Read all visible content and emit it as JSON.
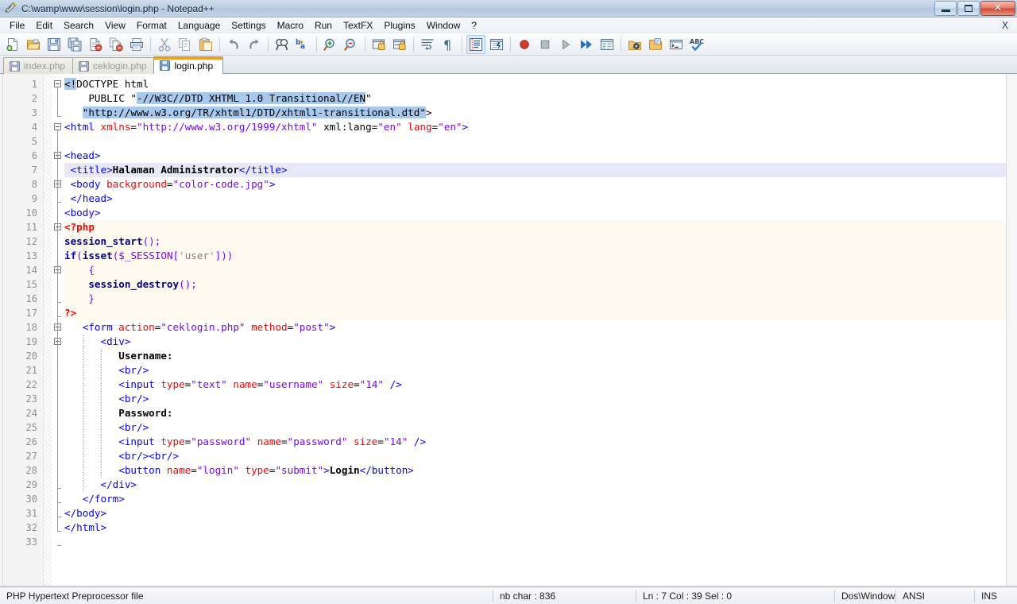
{
  "window": {
    "title": "C:\\wamp\\www\\session\\login.php - Notepad++",
    "icon": "notepad-plus-plus-icon",
    "controls": {
      "minimize": "minimize-button",
      "restore": "restore-button",
      "close": "close-button"
    },
    "accent": "#f0a024"
  },
  "menubar": {
    "items": [
      {
        "label": "File"
      },
      {
        "label": "Edit"
      },
      {
        "label": "Search"
      },
      {
        "label": "View"
      },
      {
        "label": "Format"
      },
      {
        "label": "Language"
      },
      {
        "label": "Settings"
      },
      {
        "label": "Macro"
      },
      {
        "label": "Run"
      },
      {
        "label": "TextFX"
      },
      {
        "label": "Plugins"
      },
      {
        "label": "Window"
      },
      {
        "label": "?"
      }
    ],
    "close_document": "X"
  },
  "toolbar": {
    "buttons": [
      {
        "name": "new-file-icon"
      },
      {
        "name": "open-file-icon"
      },
      {
        "name": "save-icon"
      },
      {
        "name": "save-all-icon"
      },
      {
        "name": "close-file-icon"
      },
      {
        "name": "close-all-files-icon"
      },
      {
        "name": "print-icon"
      },
      {
        "name": "separator"
      },
      {
        "name": "cut-icon"
      },
      {
        "name": "copy-icon"
      },
      {
        "name": "paste-icon"
      },
      {
        "name": "separator"
      },
      {
        "name": "undo-icon"
      },
      {
        "name": "redo-icon"
      },
      {
        "name": "separator"
      },
      {
        "name": "find-icon"
      },
      {
        "name": "replace-icon"
      },
      {
        "name": "separator"
      },
      {
        "name": "zoom-in-icon"
      },
      {
        "name": "zoom-out-icon"
      },
      {
        "name": "separator"
      },
      {
        "name": "sync-vertical-scroll-icon"
      },
      {
        "name": "sync-horizontal-scroll-icon"
      },
      {
        "name": "separator"
      },
      {
        "name": "word-wrap-icon"
      },
      {
        "name": "show-all-characters-icon"
      },
      {
        "name": "separator"
      },
      {
        "name": "indent-guideline-icon"
      },
      {
        "name": "user-defined-dialog-icon"
      },
      {
        "name": "separator"
      },
      {
        "name": "record-macro-icon"
      },
      {
        "name": "stop-recording-macro-icon"
      },
      {
        "name": "play-macro-icon"
      },
      {
        "name": "run-macro-multiple-times-icon"
      },
      {
        "name": "save-macro-icon"
      },
      {
        "name": "separator"
      },
      {
        "name": "run-icon"
      },
      {
        "name": "open-folder-icon"
      },
      {
        "name": "launch-console-icon"
      },
      {
        "name": "spell-check-icon"
      }
    ]
  },
  "tabs": [
    {
      "label": "index.php",
      "active": false,
      "icon": "saved-file-icon"
    },
    {
      "label": "ceklogin.php",
      "active": false,
      "icon": "saved-file-icon"
    },
    {
      "label": "login.php",
      "active": true,
      "icon": "saved-file-icon"
    }
  ],
  "editor": {
    "line_count": 33,
    "current_line": 7,
    "lines": [
      {
        "n": 1,
        "indent": 0,
        "bg": "none",
        "tokens": [
          {
            "t": "<!",
            "c": "t-dtd",
            "sel": true
          },
          {
            "t": "DOCTYPE html",
            "c": "t-dtd"
          }
        ]
      },
      {
        "n": 2,
        "indent": 0,
        "bg": "none",
        "tokens": [
          {
            "t": "    PUBLIC \"",
            "c": "t-dtd"
          },
          {
            "t": "-//W3C//DTD XHTML 1.0 Transitional//EN",
            "c": "t-dtd",
            "sel": true
          },
          {
            "t": "\"",
            "c": "t-dtd"
          }
        ]
      },
      {
        "n": 3,
        "indent": 0,
        "bg": "none",
        "tokens": [
          {
            "t": "   ",
            "c": "t-dtd"
          },
          {
            "t": "\"http://www.w3.org/TR/xhtml1/DTD/xhtml1-transitional.dtd\"",
            "c": "t-dtd",
            "sel": true
          },
          {
            "t": ">",
            "c": "t-dtd"
          }
        ]
      },
      {
        "n": 4,
        "indent": 0,
        "bg": "none",
        "tokens": [
          {
            "t": "<html ",
            "c": "t-tag"
          },
          {
            "t": "xmlns",
            "c": "t-attr"
          },
          {
            "t": "=",
            "c": "t-plain"
          },
          {
            "t": "\"http://www.w3.org/1999/xhtml\"",
            "c": "t-val"
          },
          {
            "t": " xml:lang",
            "c": "t-plain"
          },
          {
            "t": "=",
            "c": "t-plain"
          },
          {
            "t": "\"en\"",
            "c": "t-val"
          },
          {
            "t": " ",
            "c": "t-plain"
          },
          {
            "t": "lang",
            "c": "t-attr"
          },
          {
            "t": "=",
            "c": "t-plain"
          },
          {
            "t": "\"en\"",
            "c": "t-val"
          },
          {
            "t": ">",
            "c": "t-tag"
          }
        ]
      },
      {
        "n": 5,
        "indent": 0,
        "bg": "none",
        "tokens": []
      },
      {
        "n": 6,
        "indent": 0,
        "bg": "none",
        "tokens": [
          {
            "t": "<head>",
            "c": "t-tag"
          }
        ]
      },
      {
        "n": 7,
        "indent": 0,
        "bg": "curline",
        "tokens": [
          {
            "t": " <title>",
            "c": "t-tag"
          },
          {
            "t": "Halaman Administrator",
            "c": "t-txt"
          },
          {
            "t": "</title>",
            "c": "t-tag"
          }
        ]
      },
      {
        "n": 8,
        "indent": 0,
        "bg": "none",
        "tokens": [
          {
            "t": " <body ",
            "c": "t-tag"
          },
          {
            "t": "background",
            "c": "t-attr"
          },
          {
            "t": "=",
            "c": "t-plain"
          },
          {
            "t": "\"color-code.jpg\"",
            "c": "t-val"
          },
          {
            "t": ">",
            "c": "t-tag"
          }
        ]
      },
      {
        "n": 9,
        "indent": 0,
        "bg": "none",
        "tokens": [
          {
            "t": " </head>",
            "c": "t-tag"
          }
        ]
      },
      {
        "n": 10,
        "indent": 0,
        "bg": "none",
        "tokens": [
          {
            "t": "<body>",
            "c": "t-tag"
          }
        ]
      },
      {
        "n": 11,
        "indent": 0,
        "bg": "php",
        "tokens": [
          {
            "t": "<?php",
            "c": "t-php"
          }
        ]
      },
      {
        "n": 12,
        "indent": 0,
        "bg": "php",
        "tokens": [
          {
            "t": "session_start",
            "c": "t-fn"
          },
          {
            "t": "();",
            "c": "t-sym"
          }
        ]
      },
      {
        "n": 13,
        "indent": 0,
        "bg": "php",
        "tokens": [
          {
            "t": "if",
            "c": "t-kw"
          },
          {
            "t": "(",
            "c": "t-sym"
          },
          {
            "t": "isset",
            "c": "t-fn"
          },
          {
            "t": "(",
            "c": "t-sym"
          },
          {
            "t": "$_SESSION",
            "c": "t-var"
          },
          {
            "t": "[",
            "c": "t-sym"
          },
          {
            "t": "'user'",
            "c": "t-str"
          },
          {
            "t": "]))",
            "c": "t-sym"
          }
        ]
      },
      {
        "n": 14,
        "indent": 0,
        "bg": "php",
        "tokens": [
          {
            "t": "    {",
            "c": "t-sym"
          }
        ]
      },
      {
        "n": 15,
        "indent": 0,
        "bg": "php",
        "tokens": [
          {
            "t": "    ",
            "c": "t-plain"
          },
          {
            "t": "session_destroy",
            "c": "t-fn"
          },
          {
            "t": "();",
            "c": "t-sym"
          }
        ]
      },
      {
        "n": 16,
        "indent": 0,
        "bg": "php",
        "tokens": [
          {
            "t": "    }",
            "c": "t-sym"
          }
        ]
      },
      {
        "n": 17,
        "indent": 0,
        "bg": "php",
        "tokens": [
          {
            "t": "?>",
            "c": "t-php"
          }
        ]
      },
      {
        "n": 18,
        "indent": 0,
        "bg": "none",
        "tokens": [
          {
            "t": "   <form ",
            "c": "t-tag"
          },
          {
            "t": "action",
            "c": "t-attr"
          },
          {
            "t": "=",
            "c": "t-plain"
          },
          {
            "t": "\"ceklogin.php\"",
            "c": "t-val"
          },
          {
            "t": " ",
            "c": "t-plain"
          },
          {
            "t": "method",
            "c": "t-attr"
          },
          {
            "t": "=",
            "c": "t-plain"
          },
          {
            "t": "\"post\"",
            "c": "t-val"
          },
          {
            "t": ">",
            "c": "t-tag"
          }
        ]
      },
      {
        "n": 19,
        "indent": 0,
        "bg": "none",
        "tokens": [
          {
            "t": "      <div>",
            "c": "t-tag"
          }
        ]
      },
      {
        "n": 20,
        "indent": 0,
        "bg": "none",
        "tokens": [
          {
            "t": "         Username:",
            "c": "t-txt"
          }
        ]
      },
      {
        "n": 21,
        "indent": 0,
        "bg": "none",
        "tokens": [
          {
            "t": "         <br/>",
            "c": "t-tag"
          }
        ]
      },
      {
        "n": 22,
        "indent": 0,
        "bg": "none",
        "tokens": [
          {
            "t": "         <input ",
            "c": "t-tag"
          },
          {
            "t": "type",
            "c": "t-attr"
          },
          {
            "t": "=",
            "c": "t-plain"
          },
          {
            "t": "\"text\"",
            "c": "t-val"
          },
          {
            "t": " ",
            "c": "t-plain"
          },
          {
            "t": "name",
            "c": "t-attr"
          },
          {
            "t": "=",
            "c": "t-plain"
          },
          {
            "t": "\"username\"",
            "c": "t-val"
          },
          {
            "t": " ",
            "c": "t-plain"
          },
          {
            "t": "size",
            "c": "t-attr"
          },
          {
            "t": "=",
            "c": "t-plain"
          },
          {
            "t": "\"14\"",
            "c": "t-val"
          },
          {
            "t": " />",
            "c": "t-tag"
          }
        ]
      },
      {
        "n": 23,
        "indent": 0,
        "bg": "none",
        "tokens": [
          {
            "t": "         <br/>",
            "c": "t-tag"
          }
        ]
      },
      {
        "n": 24,
        "indent": 0,
        "bg": "none",
        "tokens": [
          {
            "t": "         Password:",
            "c": "t-txt"
          }
        ]
      },
      {
        "n": 25,
        "indent": 0,
        "bg": "none",
        "tokens": [
          {
            "t": "         <br/>",
            "c": "t-tag"
          }
        ]
      },
      {
        "n": 26,
        "indent": 0,
        "bg": "none",
        "tokens": [
          {
            "t": "         <input ",
            "c": "t-tag"
          },
          {
            "t": "type",
            "c": "t-attr"
          },
          {
            "t": "=",
            "c": "t-plain"
          },
          {
            "t": "\"password\"",
            "c": "t-val"
          },
          {
            "t": " ",
            "c": "t-plain"
          },
          {
            "t": "name",
            "c": "t-attr"
          },
          {
            "t": "=",
            "c": "t-plain"
          },
          {
            "t": "\"password\"",
            "c": "t-val"
          },
          {
            "t": " ",
            "c": "t-plain"
          },
          {
            "t": "size",
            "c": "t-attr"
          },
          {
            "t": "=",
            "c": "t-plain"
          },
          {
            "t": "\"14\"",
            "c": "t-val"
          },
          {
            "t": " />",
            "c": "t-tag"
          }
        ]
      },
      {
        "n": 27,
        "indent": 0,
        "bg": "none",
        "tokens": [
          {
            "t": "         <br/><br/>",
            "c": "t-tag"
          }
        ]
      },
      {
        "n": 28,
        "indent": 0,
        "bg": "none",
        "tokens": [
          {
            "t": "         <button ",
            "c": "t-tag"
          },
          {
            "t": "name",
            "c": "t-attr"
          },
          {
            "t": "=",
            "c": "t-plain"
          },
          {
            "t": "\"login\"",
            "c": "t-val"
          },
          {
            "t": " ",
            "c": "t-plain"
          },
          {
            "t": "type",
            "c": "t-attr"
          },
          {
            "t": "=",
            "c": "t-plain"
          },
          {
            "t": "\"submit\"",
            "c": "t-val"
          },
          {
            "t": ">",
            "c": "t-tag"
          },
          {
            "t": "Login",
            "c": "t-txt"
          },
          {
            "t": "</button>",
            "c": "t-tag"
          }
        ]
      },
      {
        "n": 29,
        "indent": 0,
        "bg": "none",
        "tokens": [
          {
            "t": "      </div>",
            "c": "t-tag"
          }
        ]
      },
      {
        "n": 30,
        "indent": 0,
        "bg": "none",
        "tokens": [
          {
            "t": "   </form>",
            "c": "t-tag"
          }
        ]
      },
      {
        "n": 31,
        "indent": 0,
        "bg": "none",
        "tokens": [
          {
            "t": "</body>",
            "c": "t-tag"
          }
        ]
      },
      {
        "n": 32,
        "indent": 0,
        "bg": "none",
        "tokens": [
          {
            "t": "</html>",
            "c": "t-tag"
          }
        ]
      },
      {
        "n": 33,
        "indent": 0,
        "bg": "none",
        "tokens": []
      }
    ]
  },
  "statusbar": {
    "file_type": "PHP Hypertext Preprocessor file",
    "char_count": "nb char : 836",
    "position": "Ln : 7    Col : 39    Sel : 0",
    "eol": "Dos\\Windows",
    "encoding": "ANSI",
    "insert_mode": "INS"
  }
}
